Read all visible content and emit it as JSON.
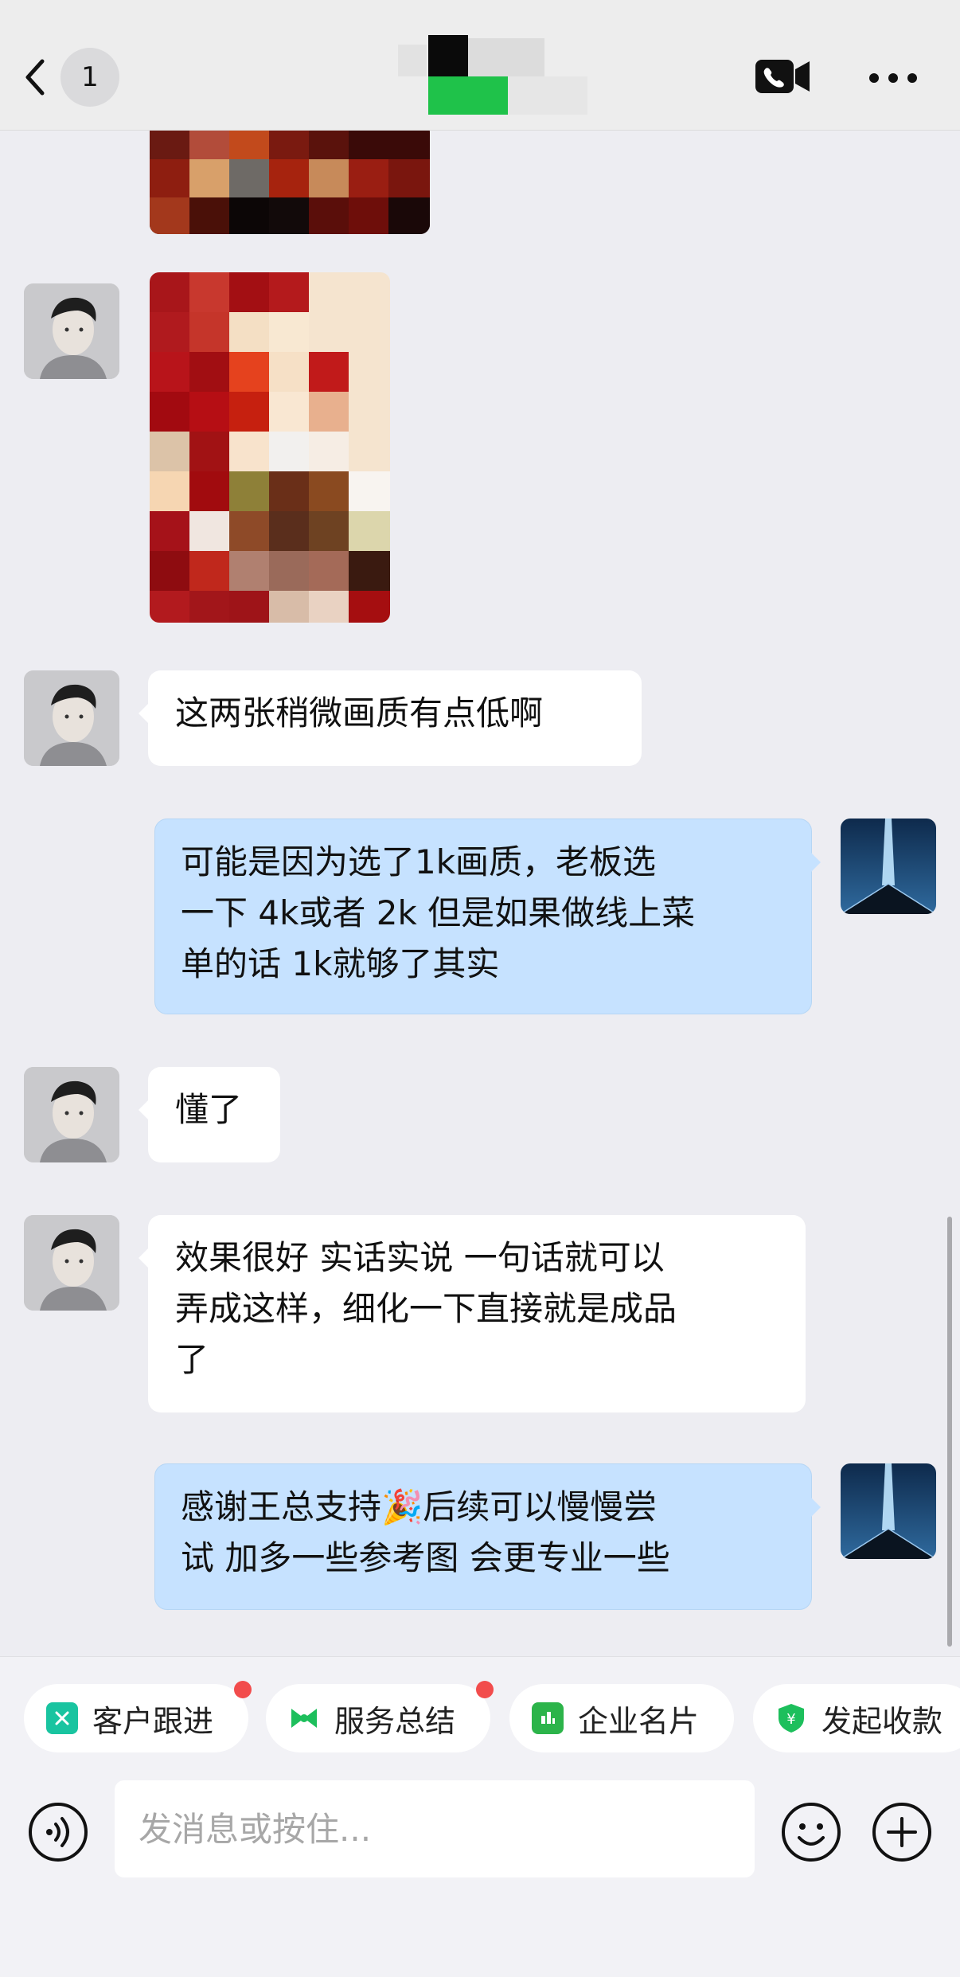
{
  "header": {
    "back_label": "返回",
    "unread_count": "1",
    "call_icon": "video-call-icon",
    "more_icon": "more-icon"
  },
  "messages": [
    {
      "side": "left",
      "type": "image",
      "description_icon": "image-thumbnail"
    },
    {
      "side": "left",
      "type": "image",
      "description_icon": "image-thumbnail"
    },
    {
      "side": "left",
      "type": "text",
      "text": "这两张稍微画质有点低啊"
    },
    {
      "side": "right",
      "type": "text",
      "lines": [
        "可能是因为选了1k画质，老板选",
        "一下 4k或者 2k 但是如果做线上菜",
        "单的话 1k就够了其实"
      ]
    },
    {
      "side": "left",
      "type": "text",
      "text": "懂了"
    },
    {
      "side": "left",
      "type": "text",
      "lines": [
        "效果很好 实话实说 一句话就可以",
        "弄成这样，细化一下直接就是成品",
        "了"
      ]
    },
    {
      "side": "right",
      "type": "text",
      "lines": [
        "感谢王总支持🎉后续可以慢慢尝",
        "试 加多一些参考图 会更专业一些"
      ]
    }
  ],
  "quick_actions": [
    {
      "label": "客户跟进",
      "icon": "follow-up-icon",
      "color": "#19C4A0",
      "badge": true
    },
    {
      "label": "服务总结",
      "icon": "bow-icon",
      "color": "#1DBF5C",
      "badge": true
    },
    {
      "label": "企业名片",
      "icon": "card-icon",
      "color": "#2CB44A",
      "badge": false
    },
    {
      "label": "发起收款",
      "icon": "yuan-shield-icon",
      "color": "#1DBF5C",
      "badge": false
    }
  ],
  "input": {
    "placeholder": "发消息或按住..."
  },
  "colors": {
    "background": "#EDEDF2",
    "bubble_left": "#FFFFFF",
    "bubble_right": "#C6E2FF",
    "badge_red": "#F24C4C"
  }
}
